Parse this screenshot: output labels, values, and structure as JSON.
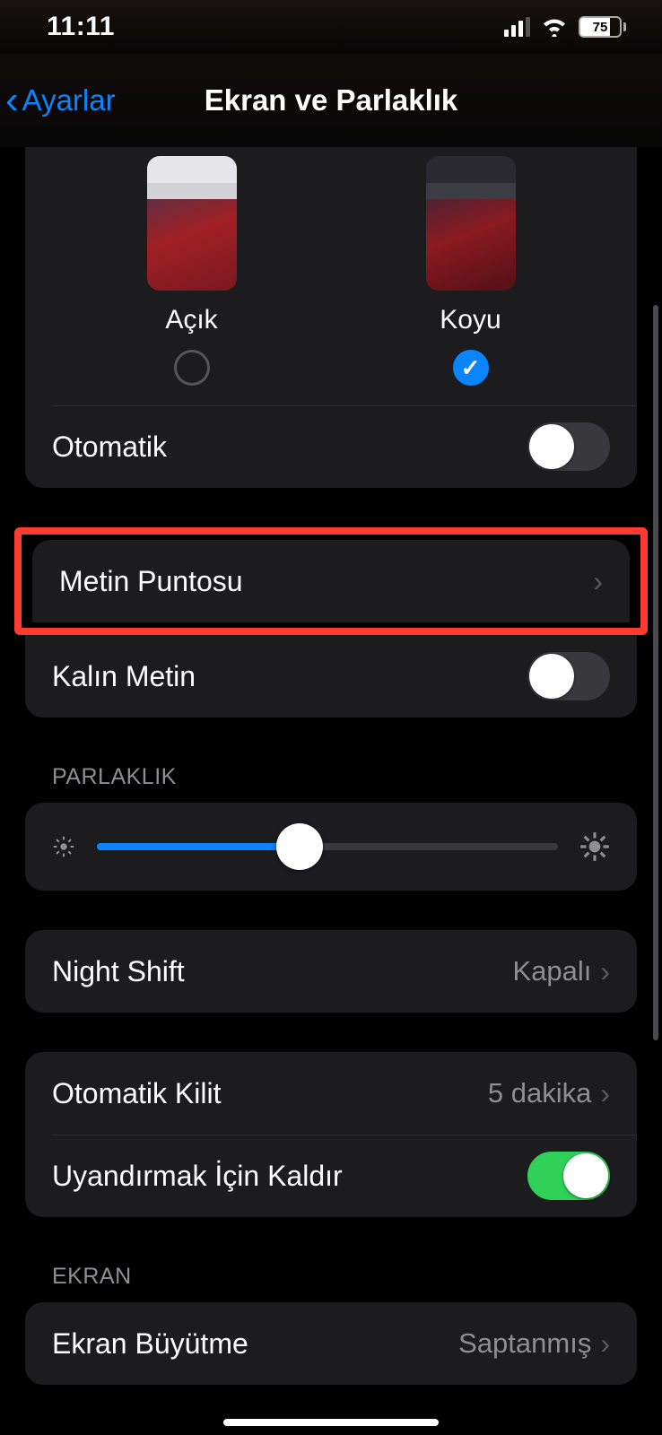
{
  "status": {
    "time": "11:11",
    "battery_pct": "75"
  },
  "nav": {
    "back_label": "Ayarlar",
    "title": "Ekran ve Parlaklık"
  },
  "appearance": {
    "light_label": "Açık",
    "dark_label": "Koyu",
    "automatic_label": "Otomatik",
    "selected": "dark"
  },
  "text": {
    "text_size_label": "Metin Puntosu",
    "bold_text_label": "Kalın Metin"
  },
  "brightness": {
    "section": "PARLAKLIK"
  },
  "night_shift": {
    "label": "Night Shift",
    "value": "Kapalı"
  },
  "auto_lock": {
    "label": "Otomatik Kilit",
    "value": "5 dakika"
  },
  "raise_to_wake": {
    "label": "Uyandırmak İçin Kaldır"
  },
  "screen": {
    "section": "EKRAN",
    "zoom_label": "Ekran Büyütme",
    "zoom_value": "Saptanmış"
  }
}
